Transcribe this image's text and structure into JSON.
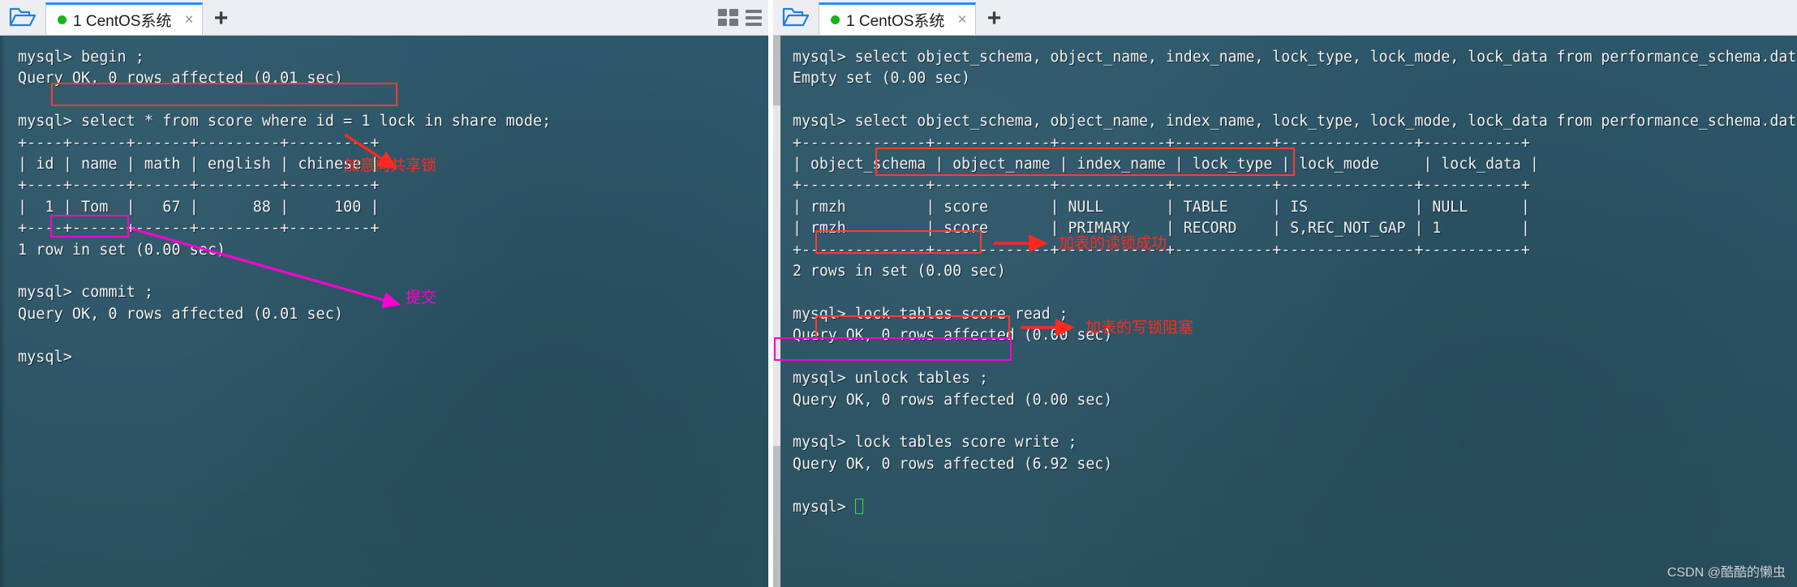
{
  "window": {
    "left_pane": {
      "toolbar": {
        "folder_icon": "folder-open-icon",
        "new_tab_label": "+",
        "grid_view_icon": "grid-view-icon",
        "list_view_icon": "list-view-icon"
      },
      "tab": {
        "label": "1 CentOS系统",
        "status_dot_color": "#18b318",
        "close_label": "×"
      },
      "terminal": {
        "lines": [
          "mysql> begin ;",
          "Query OK, 0 rows affected (0.01 sec)",
          "",
          "mysql> select * from score where id = 1 lock in share mode;",
          "+----+------+------+---------+---------+",
          "| id | name | math | english | chinese |",
          "+----+------+------+---------+---------+",
          "|  1 | Tom  |   67 |      88 |     100 |",
          "+----+------+------+---------+---------+",
          "1 row in set (0.00 sec)",
          "",
          "mysql> commit ;",
          "Query OK, 0 rows affected (0.01 sec)",
          "",
          "mysql>"
        ]
      },
      "annotations": [
        {
          "name": "share-lock-note",
          "text": "加意向共享锁",
          "color": "#ff2a1f"
        },
        {
          "name": "commit-note",
          "text": "提交",
          "color": "#ff00d4"
        }
      ]
    },
    "right_pane": {
      "toolbar": {
        "folder_icon": "folder-open-icon",
        "new_tab_label": "+"
      },
      "tab": {
        "label": "1 CentOS系统",
        "status_dot_color": "#18b318",
        "close_label": "×"
      },
      "terminal": {
        "lines": [
          "mysql> select object_schema, object_name, index_name, lock_type, lock_mode, lock_data from performance_schema.data_loc",
          "Empty set (0.00 sec)",
          "",
          "mysql> select object_schema, object_name, index_name, lock_type, lock_mode, lock_data from performance_schema.data_loc",
          "+--------------+-------------+------------+-----------+---------------+-----------+",
          "| object_schema | object_name | index_name | lock_type | lock_mode     | lock_data |",
          "+--------------+-------------+------------+-----------+---------------+-----------+",
          "| rmzh         | score       | NULL       | TABLE     | IS            | NULL      |",
          "| rmzh         | score       | PRIMARY    | RECORD    | S,REC_NOT_GAP | 1         |",
          "+--------------+-------------+------------+-----------+---------------+-----------+",
          "2 rows in set (0.00 sec)",
          "",
          "mysql> lock tables score read ;",
          "Query OK, 0 rows affected (0.00 sec)",
          "",
          "mysql> unlock tables ;",
          "Query OK, 0 rows affected (0.00 sec)",
          "",
          "mysql> lock tables score write ;",
          "Query OK, 0 rows affected (6.92 sec)",
          "",
          "mysql> "
        ]
      },
      "annotations": [
        {
          "name": "read-lock-success-note",
          "text": "加表的读锁成功",
          "color": "#ff2a1f"
        },
        {
          "name": "write-lock-block-note",
          "text": "加表的写锁阻塞",
          "color": "#ff2a1f"
        }
      ]
    }
  },
  "watermark": "CSDN @酷酷的懒虫"
}
